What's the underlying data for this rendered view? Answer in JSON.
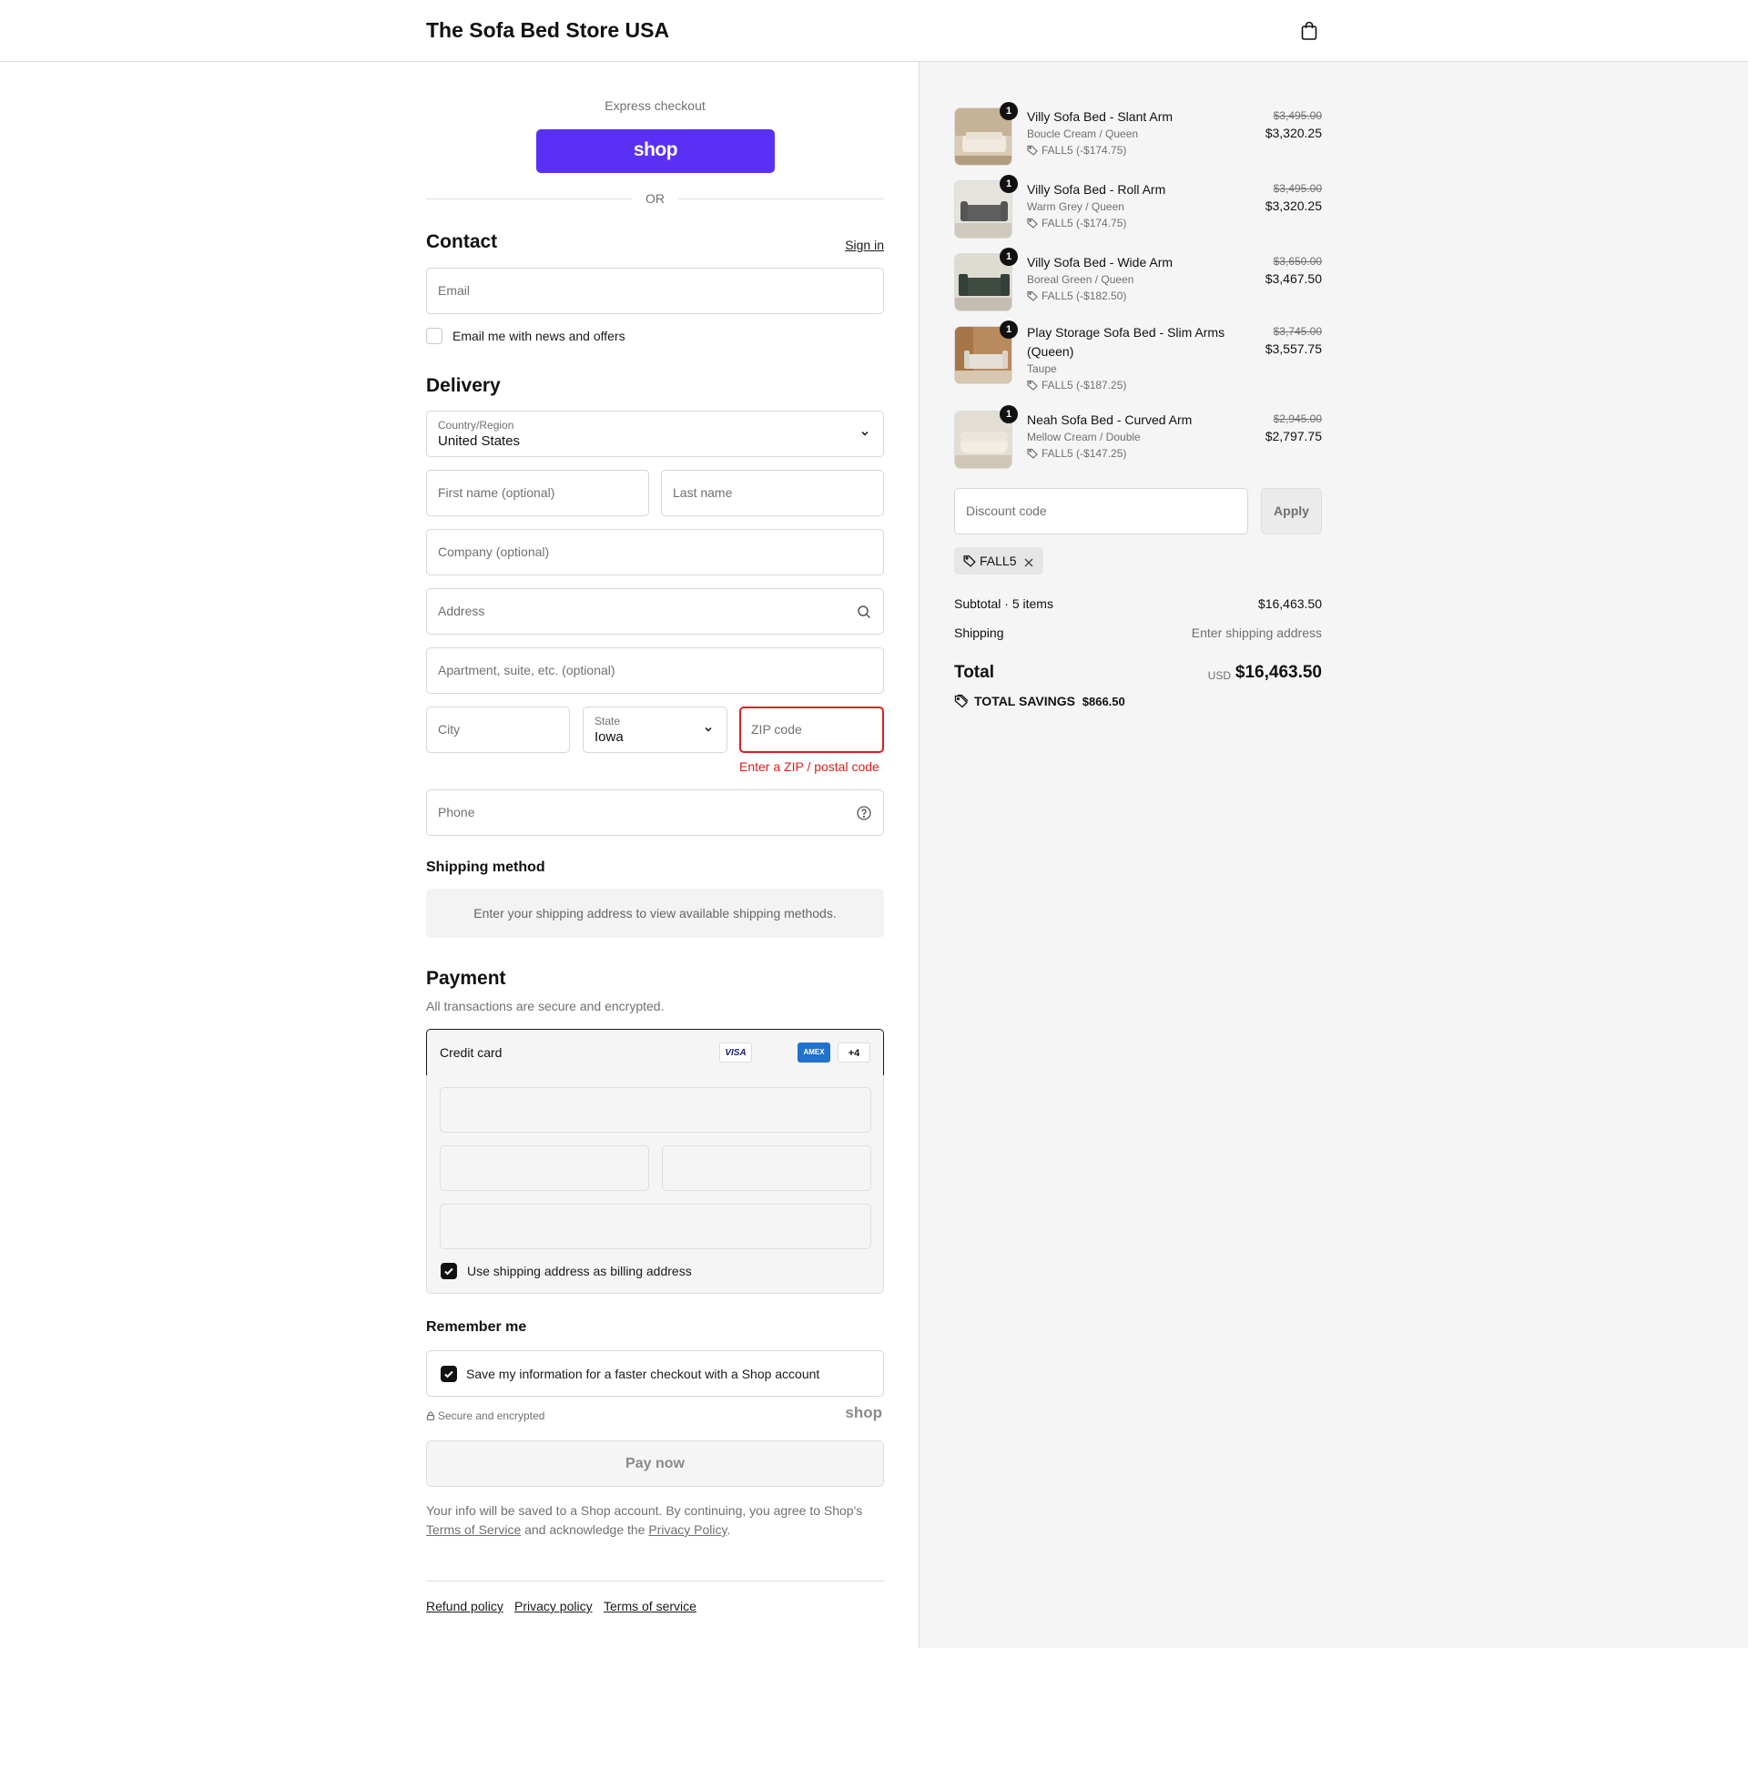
{
  "header": {
    "store_name": "The Sofa Bed Store USA",
    "cart_icon": "shopping-bag-icon"
  },
  "express": {
    "label": "Express checkout",
    "shop_button": "shop",
    "or": "OR"
  },
  "contact": {
    "title": "Contact",
    "sign_in": "Sign in",
    "email_placeholder": "Email",
    "news_label": "Email me with news and offers",
    "news_checked": false
  },
  "delivery": {
    "title": "Delivery",
    "country_label": "Country/Region",
    "country_value": "United States",
    "first_name_placeholder": "First name (optional)",
    "last_name_placeholder": "Last name",
    "company_placeholder": "Company (optional)",
    "address_placeholder": "Address",
    "apartment_placeholder": "Apartment, suite, etc. (optional)",
    "city_placeholder": "City",
    "state_label": "State",
    "state_value": "Iowa",
    "zip_placeholder": "ZIP code",
    "zip_error": "Enter a ZIP / postal code",
    "phone_placeholder": "Phone"
  },
  "shipping_method": {
    "title": "Shipping method",
    "message": "Enter your shipping address to view available shipping methods."
  },
  "payment": {
    "title": "Payment",
    "subtitle": "All transactions are secure and encrypted.",
    "method": "Credit card",
    "card_logos": [
      "VISA",
      "AMEX",
      "+4"
    ],
    "billing_label": "Use shipping address as billing address",
    "billing_checked": true
  },
  "remember": {
    "title": "Remember me",
    "save_label": "Save my information for a faster checkout with a Shop account",
    "save_checked": true,
    "secure": "Secure and encrypted",
    "shop_logo": "shop"
  },
  "pay_now": "Pay now",
  "legal": {
    "text_1": "Your info will be saved to a Shop account. By continuing, you agree to Shop's",
    "terms": "Terms of Service",
    "text_2": "and acknowledge the",
    "privacy": "Privacy Policy",
    "text_3": "."
  },
  "footer": {
    "links": [
      "Refund policy",
      "Privacy policy",
      "Terms of service"
    ]
  },
  "order": {
    "items": [
      {
        "name": "Villy Sofa Bed - Slant Arm",
        "variant": "Boucle Cream / Queen",
        "discount": "FALL5 (-$174.75)",
        "original": "$3,495.00",
        "price": "$3,320.25",
        "qty": "1"
      },
      {
        "name": "Villy Sofa Bed - Roll Arm",
        "variant": "Warm Grey / Queen",
        "discount": "FALL5 (-$174.75)",
        "original": "$3,495.00",
        "price": "$3,320.25",
        "qty": "1"
      },
      {
        "name": "Villy Sofa Bed - Wide Arm",
        "variant": "Boreal Green / Queen",
        "discount": "FALL5 (-$182.50)",
        "original": "$3,650.00",
        "price": "$3,467.50",
        "qty": "1"
      },
      {
        "name": "Play Storage Sofa Bed - Slim Arms (Queen)",
        "variant": "Taupe",
        "discount": "FALL5 (-$187.25)",
        "original": "$3,745.00",
        "price": "$3,557.75",
        "qty": "1"
      },
      {
        "name": "Neah Sofa Bed - Curved Arm",
        "variant": "Mellow Cream / Double",
        "discount": "FALL5 (-$147.25)",
        "original": "$2,945.00",
        "price": "$2,797.75",
        "qty": "1"
      }
    ],
    "discount_placeholder": "Discount code",
    "apply": "Apply",
    "applied_code": "FALL5",
    "subtotal_label": "Subtotal · 5 items",
    "subtotal_value": "$16,463.50",
    "shipping_label": "Shipping",
    "shipping_value": "Enter shipping address",
    "total_label": "Total",
    "currency": "USD",
    "total_value": "$16,463.50",
    "savings_label": "TOTAL SAVINGS",
    "savings_value": "$866.50"
  },
  "colors": {
    "shop_purple": "#5a31f4",
    "error_red": "#dd1d1d",
    "sidebar_bg": "#f5f5f5"
  }
}
